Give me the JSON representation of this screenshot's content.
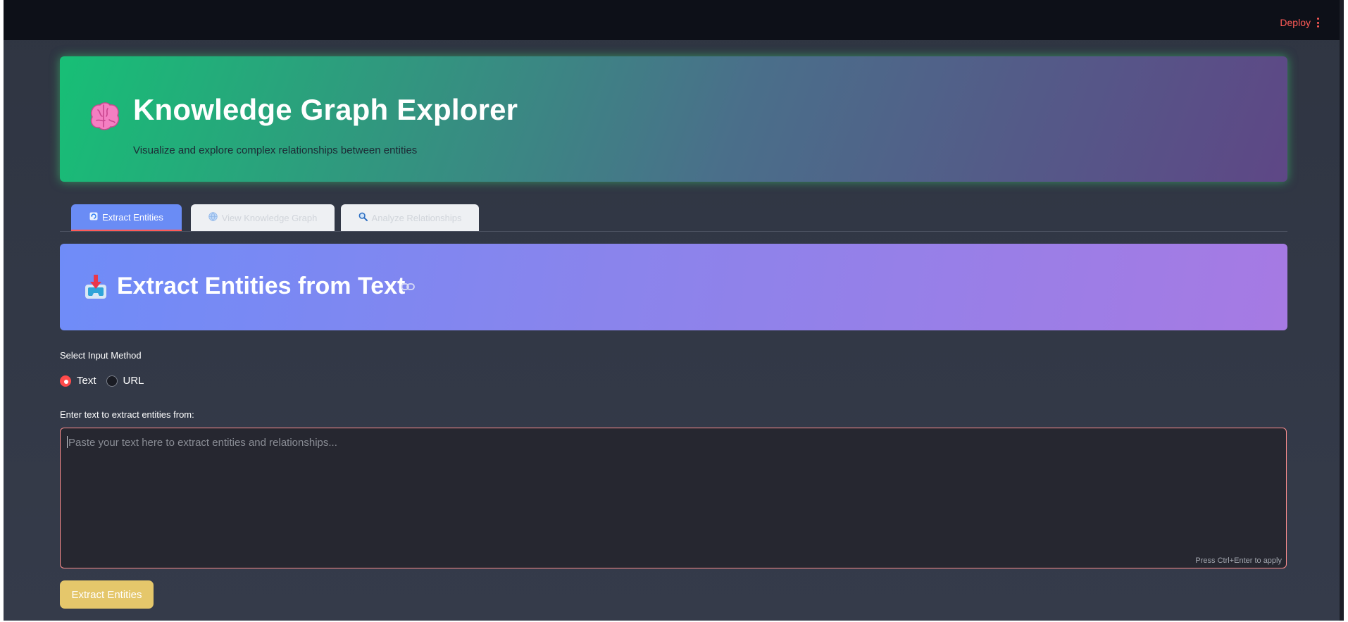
{
  "header": {
    "deploy_label": "Deploy",
    "menu_icon": "kebab-menu-icon"
  },
  "hero": {
    "icon": "brain-emoji-icon",
    "title": "Knowledge Graph Explorer",
    "subtitle": "Visualize and explore complex relationships between entities"
  },
  "tabs": [
    {
      "icon": "refresh-icon",
      "label": "Extract Entities",
      "active": true
    },
    {
      "icon": "globe-icon",
      "label": "View Knowledge Graph",
      "active": false
    },
    {
      "icon": "magnifier-icon",
      "label": "Analyze Relationships",
      "active": false
    }
  ],
  "section": {
    "icon": "inbox-tray-icon",
    "title": "Extract Entities from Text",
    "link_icon": "link-icon"
  },
  "input_method": {
    "label": "Select Input Method",
    "options": [
      "Text",
      "URL"
    ],
    "selected": "Text"
  },
  "text_input": {
    "label": "Enter text to extract entities from:",
    "value": "",
    "placeholder": "Paste your text here to extract entities and relationships...",
    "hint": "Press Ctrl+Enter to apply"
  },
  "action": {
    "button_label": "Extract Entities"
  },
  "colors": {
    "accent": "#ff4b4b",
    "button": "#e5c76b",
    "tab_active": "#6a8cf5"
  }
}
